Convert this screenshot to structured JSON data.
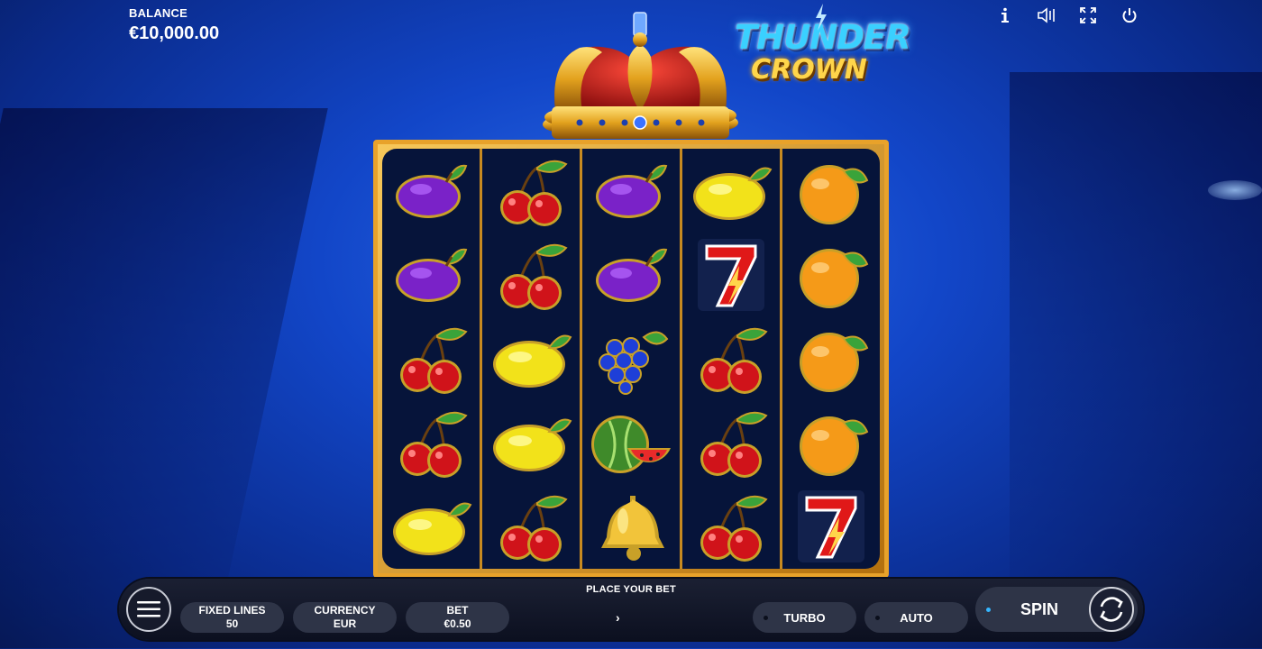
{
  "balance": {
    "label": "BALANCE",
    "value": "€10,000.00"
  },
  "logo": {
    "line1": "THUNDER",
    "line2": "CROWN"
  },
  "top_icons": [
    "info-icon",
    "sound-icon",
    "fullscreen-icon",
    "power-icon"
  ],
  "reels": [
    [
      "plum",
      "plum",
      "cherry",
      "cherry",
      "lemon"
    ],
    [
      "cherry",
      "cherry",
      "lemon",
      "lemon",
      "cherry"
    ],
    [
      "plum",
      "plum",
      "grapes",
      "watermelon",
      "bell"
    ],
    [
      "lemon",
      "seven",
      "cherry",
      "cherry",
      "cherry"
    ],
    [
      "orange",
      "orange",
      "orange",
      "orange",
      "seven"
    ]
  ],
  "bottom_bar": {
    "prompt": "PLACE YOUR BET",
    "fixed_lines": {
      "label": "FIXED LINES",
      "value": "50"
    },
    "currency": {
      "label": "CURRENCY",
      "value": "EUR"
    },
    "bet": {
      "label": "BET",
      "value": "€0.50"
    },
    "turbo_label": "TURBO",
    "auto_label": "AUTO",
    "spin_label": "SPIN"
  },
  "colors": {
    "background": "#1246c8",
    "frame_gold": "#e8a22a",
    "reel_bg": "#06143a",
    "bar_bg": "#1b2033",
    "pill_bg": "#2e3447",
    "spin_indicator": "#35b6ff"
  }
}
